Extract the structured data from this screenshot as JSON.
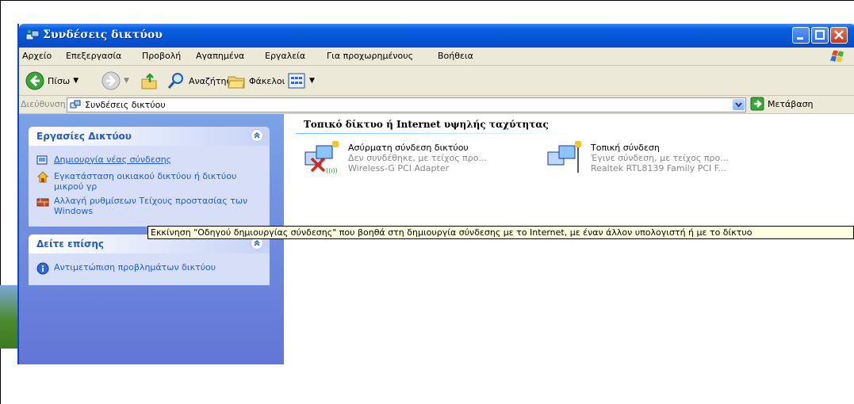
{
  "window": {
    "title": "Συνδέσεις δικτύου"
  },
  "menu": [
    "Αρχείο",
    "Επεξεργασία",
    "Προβολή",
    "Αγαπημένα",
    "Εργαλεία",
    "Για προχωρημένους",
    "Βοήθεια"
  ],
  "toolbar": {
    "back_label": "Πίσω",
    "search_label": "Αναζήτηση",
    "folders_label": "Φάκελοι"
  },
  "address": {
    "label": "Διεύθυνση",
    "value": "Συνδέσεις δικτύου",
    "go_label": "Μετάβαση"
  },
  "tasks_panel": {
    "title": "Εργασίες Δικτύου",
    "items": [
      {
        "label": "Δημιουργία νέας σύνδεσης",
        "icon": "new-connection-icon"
      },
      {
        "label": "Εγκατάσταση οικιακού δικτύου ή δικτύου μικρού γρ",
        "icon": "network-setup-icon"
      },
      {
        "label": "Αλλαγή ρυθμίσεων Τείχους προστασίας των Windows",
        "icon": "firewall-icon"
      }
    ]
  },
  "see_also_panel": {
    "title": "Δείτε επίσης",
    "items": [
      {
        "label": "Αντιμετώπιση προβλημάτων δικτύου",
        "icon": "info-icon"
      }
    ]
  },
  "content": {
    "group_title": "Τοπικό δίκτυο ή Internet υψηλής ταχύτητας",
    "connections": [
      {
        "name": "Ασύρματη σύνδεση δικτύου",
        "status": "Δεν συνδέθηκε, με τείχος προ...",
        "device": "Wireless-G PCI Adapter",
        "icon": "wireless-disconnected-icon"
      },
      {
        "name": "Τοπική σύνδεση",
        "status": "Έγινε σύνδεση, με τείχος προ...",
        "device": "Realtek RTL8139 Family PCI F...",
        "icon": "lan-connected-icon"
      }
    ]
  },
  "tooltip": "Εκκίνηση \"Οδηγού δημιουργίας σύνδεσης\" που βοηθά στη δημιουργία σύνδεσης με το Internet, με έναν άλλον υπολογιστή ή με το δίκτυο",
  "colors": {
    "title_blue": "#0553d3",
    "task_link": "#215dc6",
    "pane_bg": "#6f8ce0",
    "tooltip_bg": "#ffffe1"
  }
}
